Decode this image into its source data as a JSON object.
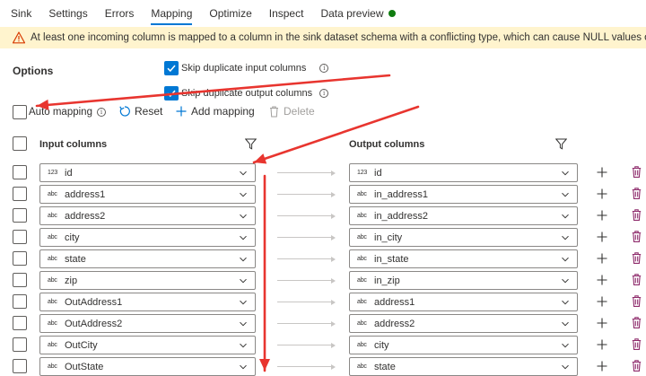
{
  "tabs": [
    {
      "label": "Sink"
    },
    {
      "label": "Settings"
    },
    {
      "label": "Errors"
    },
    {
      "label": "Mapping"
    },
    {
      "label": "Optimize"
    },
    {
      "label": "Inspect"
    },
    {
      "label": "Data preview"
    }
  ],
  "active_tab": "Mapping",
  "status_color": "#107c10",
  "accent_color": "#0078d4",
  "warning": {
    "text": "At least one incoming column is mapped to a column in the sink dataset schema with a conflicting type, which can cause NULL values or runtime errors.",
    "color": "#d83b01"
  },
  "options": {
    "label": "Options",
    "skip_input": {
      "label": "Skip duplicate input columns",
      "checked": true
    },
    "skip_output": {
      "label": "Skip duplicate output columns",
      "checked": true
    }
  },
  "toolbar": {
    "auto_mapping": {
      "label": "Auto mapping",
      "checked": false
    },
    "reset": "Reset",
    "add_mapping": "Add mapping",
    "delete": "Delete"
  },
  "grid": {
    "input_header": "Input columns",
    "output_header": "Output columns",
    "rows": [
      {
        "in_type": "123",
        "input": "id",
        "out_type": "123",
        "output": "id"
      },
      {
        "in_type": "abc",
        "input": "address1",
        "out_type": "abc",
        "output": "in_address1"
      },
      {
        "in_type": "abc",
        "input": "address2",
        "out_type": "abc",
        "output": "in_address2"
      },
      {
        "in_type": "abc",
        "input": "city",
        "out_type": "abc",
        "output": "in_city"
      },
      {
        "in_type": "abc",
        "input": "state",
        "out_type": "abc",
        "output": "in_state"
      },
      {
        "in_type": "abc",
        "input": "zip",
        "out_type": "abc",
        "output": "in_zip"
      },
      {
        "in_type": "abc",
        "input": "OutAddress1",
        "out_type": "abc",
        "output": "address1"
      },
      {
        "in_type": "abc",
        "input": "OutAddress2",
        "out_type": "abc",
        "output": "address2"
      },
      {
        "in_type": "abc",
        "input": "OutCity",
        "out_type": "abc",
        "output": "city"
      },
      {
        "in_type": "abc",
        "input": "OutState",
        "out_type": "abc",
        "output": "state"
      }
    ]
  },
  "annotation_color": "#e8352f",
  "delete_icon_color": "#8e2a6b"
}
